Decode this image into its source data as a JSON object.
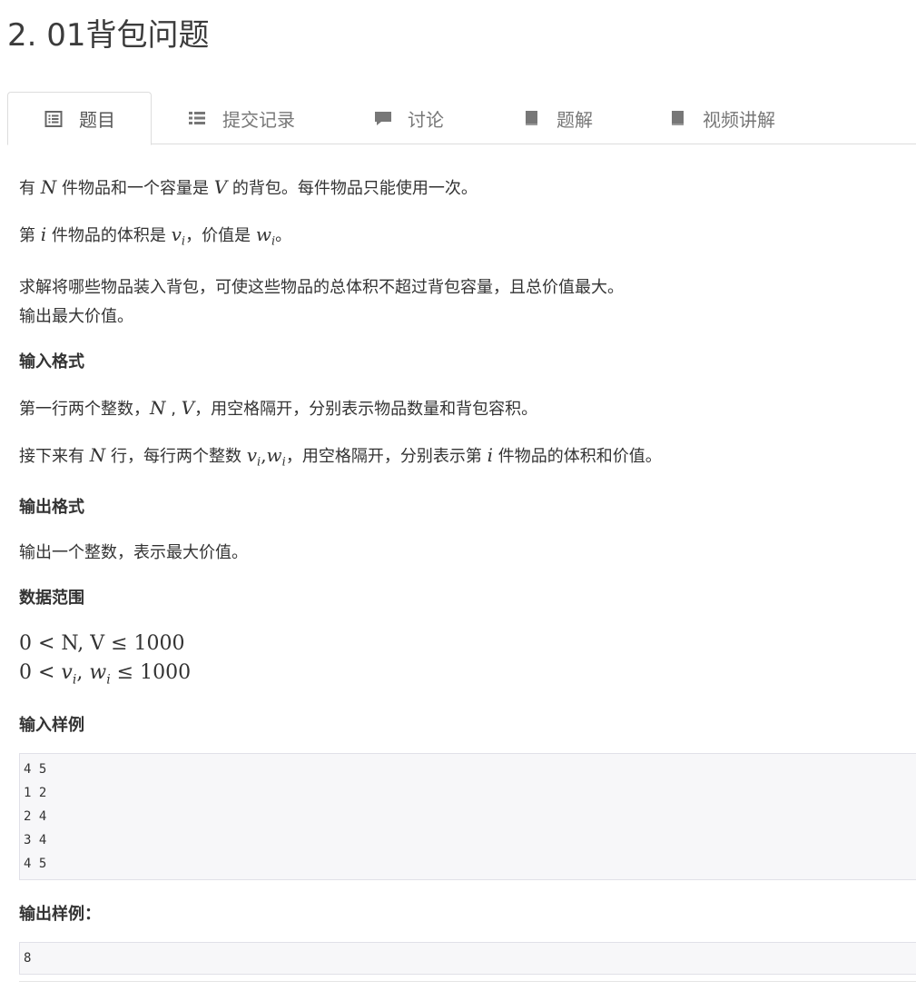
{
  "problem": {
    "title": "2. 01背包问题"
  },
  "tabs": [
    {
      "label": "题目",
      "icon": "list-alt-icon",
      "active": true
    },
    {
      "label": "提交记录",
      "icon": "list-icon",
      "active": false
    },
    {
      "label": "讨论",
      "icon": "comment-icon",
      "active": false
    },
    {
      "label": "题解",
      "icon": "book-icon",
      "active": false
    },
    {
      "label": "视频讲解",
      "icon": "book-icon",
      "active": false
    }
  ],
  "description": {
    "p1_a": "有",
    "p1_N": "N",
    "p1_b": "件物品和一个容量是",
    "p1_V": "V",
    "p1_c": "的背包。每件物品只能使用一次。",
    "p2_a": "第",
    "p2_i": "i",
    "p2_b": "件物品的体积是",
    "p2_v": "v",
    "p2_vsub": "i",
    "p2_c": "，价值是",
    "p2_w": "w",
    "p2_wsub": "i",
    "p2_d": "。",
    "p3_line1": "求解将哪些物品装入背包，可使这些物品的总体积不超过背包容量，且总价值最大。",
    "p3_line2": "输出最大价值。"
  },
  "input_format": {
    "heading": "输入格式",
    "l1_a": "第一行两个整数，",
    "l1_N": "N",
    "l1_sep": " , ",
    "l1_V": "V",
    "l1_b": "，用空格隔开，分别表示物品数量和背包容积。",
    "l2_a": "接下来有",
    "l2_N": "N",
    "l2_b": "行，每行两个整数",
    "l2_v": "v",
    "l2_vsub": "i",
    "l2_comma": ",",
    "l2_w": "w",
    "l2_wsub": "i",
    "l2_c": "，用空格隔开，分别表示第",
    "l2_i": "i",
    "l2_d": "件物品的体积和价值。"
  },
  "output_format": {
    "heading": "输出格式",
    "text": "输出一个整数，表示最大价值。"
  },
  "data_range": {
    "heading": "数据范围",
    "line1": "0 < N, V ≤ 1000",
    "line2_a": "0 < ",
    "line2_v": "v",
    "line2_vsub": "i",
    "line2_comma": ", ",
    "line2_w": "w",
    "line2_wsub": "i",
    "line2_b": " ≤ 1000"
  },
  "sample_input": {
    "heading": "输入样例",
    "code": "4 5\n1 2\n2 4\n3 4\n4 5"
  },
  "sample_output": {
    "heading": "输出样例：",
    "code": "8"
  }
}
